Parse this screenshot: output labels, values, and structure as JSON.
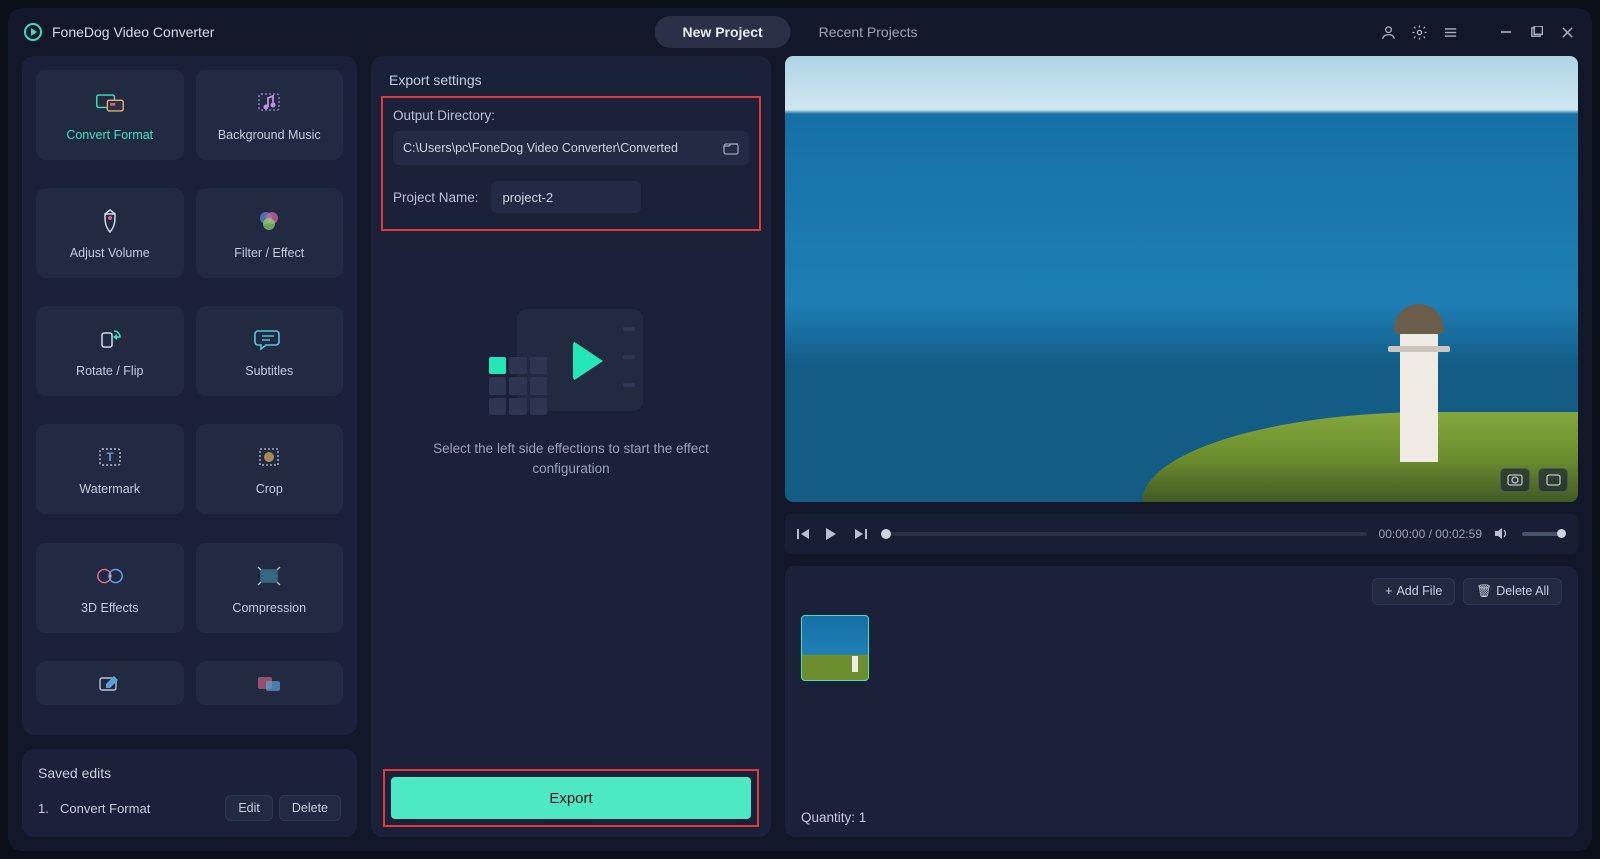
{
  "app": {
    "title": "FoneDog Video Converter"
  },
  "tabs": {
    "new": "New Project",
    "recent": "Recent Projects"
  },
  "tools": [
    {
      "id": "convert-format",
      "label": "Convert Format",
      "active": true
    },
    {
      "id": "background-music",
      "label": "Background Music"
    },
    {
      "id": "adjust-volume",
      "label": "Adjust Volume"
    },
    {
      "id": "filter-effect",
      "label": "Filter / Effect"
    },
    {
      "id": "rotate-flip",
      "label": "Rotate / Flip"
    },
    {
      "id": "subtitles",
      "label": "Subtitles"
    },
    {
      "id": "watermark",
      "label": "Watermark"
    },
    {
      "id": "crop",
      "label": "Crop"
    },
    {
      "id": "3d-effects",
      "label": "3D Effects"
    },
    {
      "id": "compression",
      "label": "Compression"
    }
  ],
  "saved": {
    "title": "Saved edits",
    "items": [
      {
        "idx": "1.",
        "name": "Convert Format"
      }
    ],
    "edit": "Edit",
    "delete": "Delete"
  },
  "export": {
    "title": "Export settings",
    "outdir_label": "Output Directory:",
    "outdir_value": "C:\\Users\\pc\\FoneDog Video Converter\\Converted",
    "projname_label": "Project Name:",
    "projname_value": "project-2",
    "hint": "Select the left side effections to start the effect configuration",
    "button": "Export"
  },
  "player": {
    "time_current": "00:00:00",
    "time_total": "00:02:59"
  },
  "files": {
    "addfile": "Add File",
    "deleteall": "Delete All",
    "quantity_label": "Quantity:",
    "quantity_value": "1"
  }
}
